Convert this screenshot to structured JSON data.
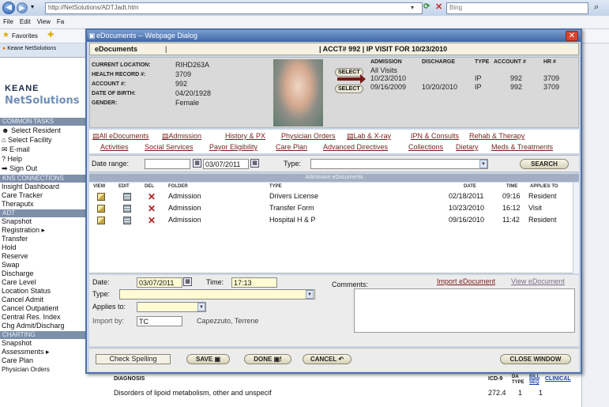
{
  "browser": {
    "url": "http://NetSolutions/ADTJadt.htm",
    "search_placeholder": "Bing",
    "menu": [
      "File",
      "Edit",
      "View",
      "Fa"
    ],
    "favorites_label": "Favorites",
    "tab_label": "Keane NetSolutions"
  },
  "leftnav": {
    "brand_top": "KEANE",
    "brand_bottom": "NetSolutions",
    "common_tasks_title": "COMMON TASKS",
    "common_tasks": [
      "Select Resident",
      "Select Facility",
      "E-mail",
      "Help",
      "Sign Out"
    ],
    "kns_title": "KNS CONNECTIONS",
    "kns": [
      "Insight Dashboard",
      "Care Tracker",
      "Theraputx"
    ],
    "adt_title": "ADT",
    "adt": [
      "Snapshot",
      "Registration ▸",
      "Transfer",
      "Hold",
      "Reserve",
      "Swap",
      "Discharge",
      "Care Level",
      "Location Status",
      "Cancel Admit",
      "Cancel Outpatient",
      "Central Res. Index",
      "Chg Admit/Discharg"
    ],
    "charting_title": "CHARTING",
    "charting": [
      "Snapshot",
      "Assessments ▸",
      "Care Plan",
      "Physician Orders"
    ]
  },
  "dialog": {
    "title": "eDocuments -- Webpage Dialog",
    "header_left": "eDocuments",
    "header_right": "| ACCT# 992 | IP VISIT FOR 10/23/2010",
    "patient": {
      "labels": [
        "CURRENT LOCATION:",
        "HEALTH RECORD #:",
        "ACCOUNT #:",
        "DATE OF BIRTH:",
        "GENDER:"
      ],
      "values": [
        "RIHD263A",
        "3709",
        "992",
        "04/20/1928",
        "Female"
      ]
    },
    "admissions": {
      "headers": [
        "ADMISSION",
        "DISCHARGE",
        "TYPE",
        "ACCOUNT #",
        "HR #"
      ],
      "select_label": "SELECT",
      "all_visits": "All Visits",
      "rows": [
        {
          "admission": "10/23/2010",
          "discharge": "",
          "type": "IP",
          "account": "992",
          "hr": "3709"
        },
        {
          "admission": "09/16/2009",
          "discharge": "10/20/2010",
          "type": "IP",
          "account": "992",
          "hr": "3709"
        }
      ]
    },
    "links_row1": [
      "All eDocuments",
      "Admission",
      "History & PX",
      "Physician Orders",
      "Lab & X-ray",
      "IPN & Consults",
      "Rehab & Therapy"
    ],
    "links_row2": [
      "Activities",
      "Social Services",
      "Payor Eligibility",
      "Care Plan",
      "Advanced Directives",
      "Collections",
      "Dietary",
      "Meds & Treatments"
    ],
    "filter": {
      "date_range_label": "Date range:",
      "date_from": "",
      "date_to": "03/07/2011",
      "type_label": "Type:",
      "type_value": "",
      "search_label": "SEARCH"
    },
    "band_title": "Admission eDocuments",
    "doc_headers": [
      "VIEW",
      "EDIT",
      "DEL",
      "FOLDER",
      "TYPE",
      "DATE",
      "TIME",
      "APPLIES TO"
    ],
    "documents": [
      {
        "folder": "Admission",
        "type": "Drivers License",
        "date": "02/18/2011",
        "time": "09:16",
        "applies": "Resident"
      },
      {
        "folder": "Admission",
        "type": "Transfer Form",
        "date": "10/23/2010",
        "time": "16:12",
        "applies": "Visit"
      },
      {
        "folder": "Admission",
        "type": "Hospital H & P",
        "date": "09/16/2010",
        "time": "11:42",
        "applies": "Resident"
      }
    ],
    "form": {
      "date_label": "Date:",
      "date_value": "03/07/2011",
      "time_label": "Time:",
      "time_value": "17:13",
      "comments_label": "Comments:",
      "import_link": "Import eDocument",
      "view_link": "View eDocument",
      "type_label": "Type:",
      "applies_label": "Applies to:",
      "import_by_label": "Import by:",
      "import_by_value": "TC",
      "import_by_name": "Capezzuto, Terrene"
    },
    "buttons": {
      "spell": "Check Spelling",
      "save": "SAVE",
      "done": "DONE",
      "cancel": "CANCEL",
      "close": "CLOSE WINDOW"
    }
  },
  "under": {
    "diagnosis_header": "DIAGNOSIS",
    "icd_header": "ICD-9",
    "da_type_header": "DA TYPE",
    "bill_seq_header": "BILL SEQ",
    "clinical_header": "CLINICAL",
    "row_text": "Disorders of lipoid metabolism, other and unspecif",
    "row_icd": "272.4",
    "row_type": "1",
    "row_seq": "1"
  }
}
